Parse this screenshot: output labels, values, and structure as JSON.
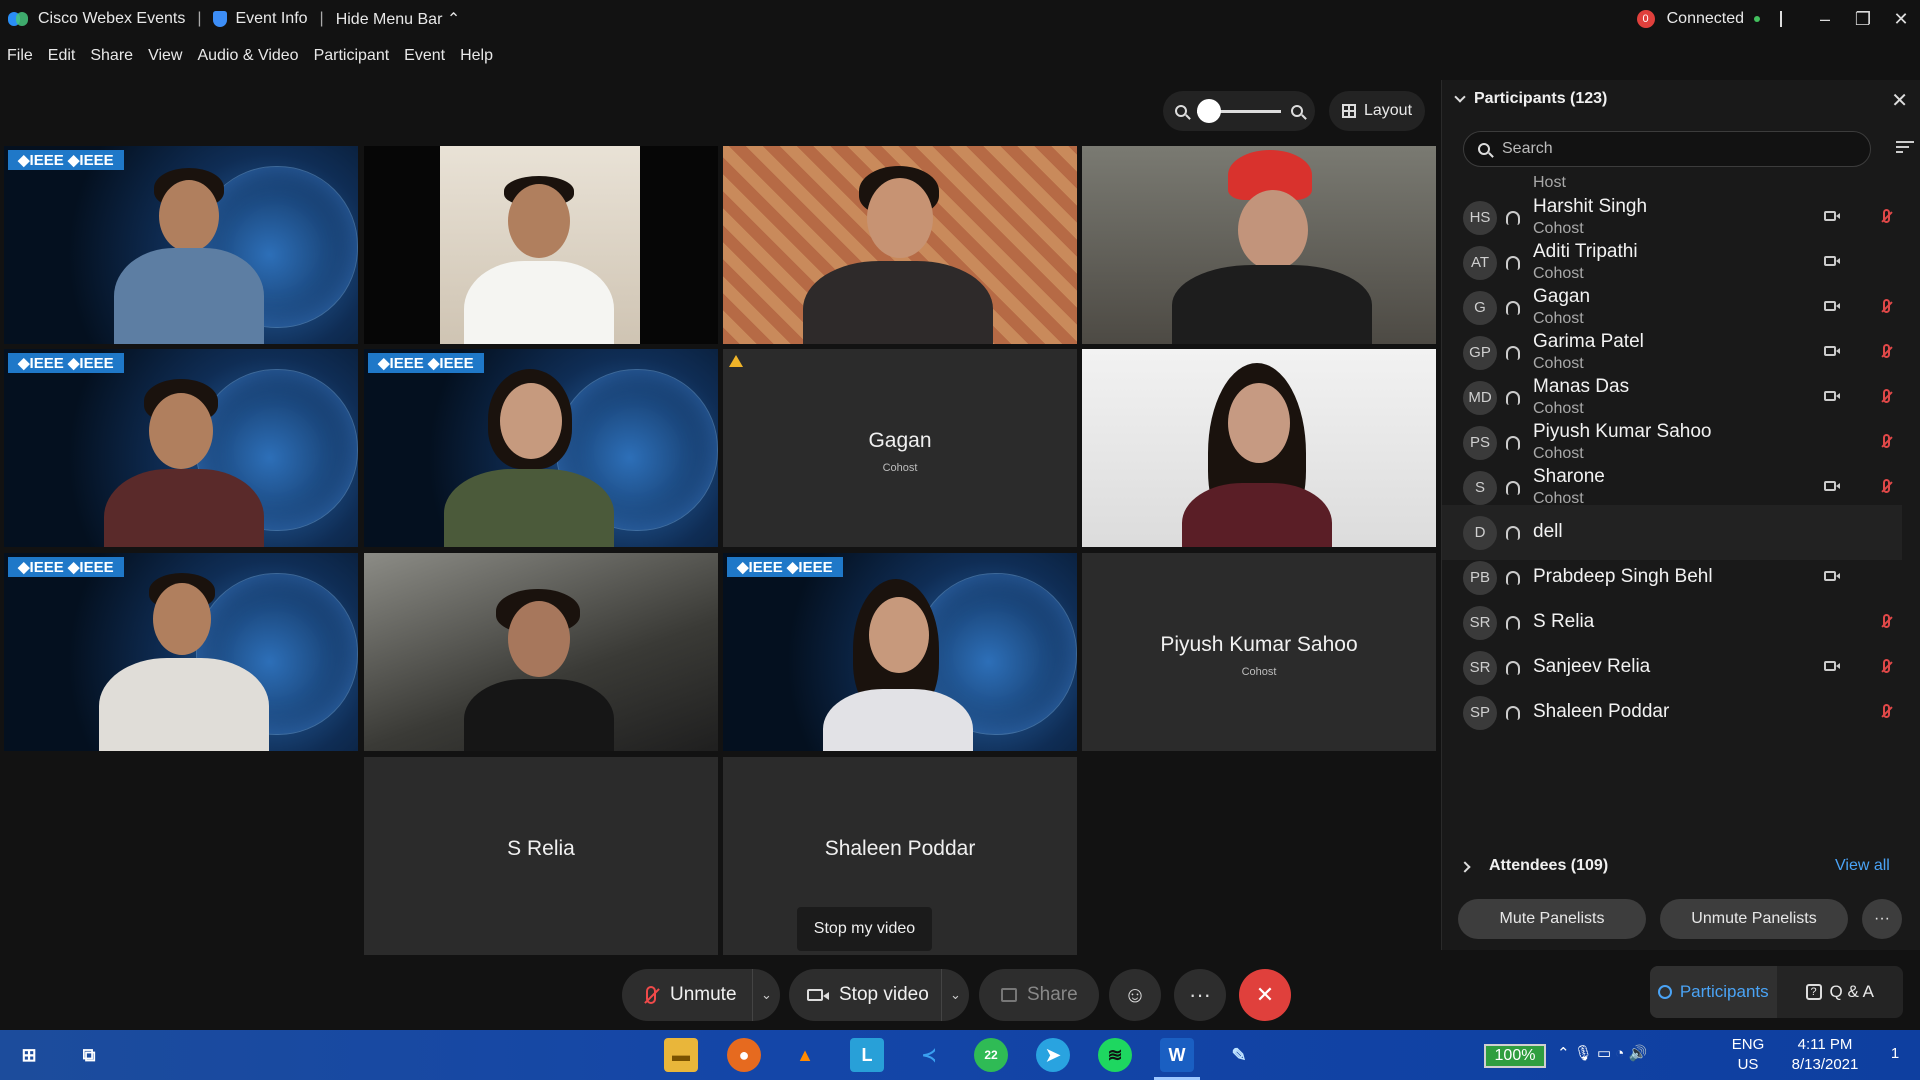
{
  "titlebar": {
    "app_name": "Cisco Webex Events",
    "event_info": "Event Info",
    "hide_menu": "Hide Menu Bar",
    "connection_count": "0",
    "connection_status": "Connected"
  },
  "menu": [
    "File",
    "Edit",
    "Share",
    "View",
    "Audio & Video",
    "Participant",
    "Event",
    "Help"
  ],
  "toolbar": {
    "layout_label": "Layout",
    "zoom_level": 0.0
  },
  "tiles": {
    "gagan": {
      "name": "Gagan",
      "role": "Cohost"
    },
    "piyush": {
      "name": "Piyush Kumar Sahoo",
      "role": "Cohost"
    },
    "srelia": {
      "name": "S Relia"
    },
    "shaleen": {
      "name": "Shaleen Poddar"
    },
    "ieee_badge": "◆IEEE ◆IEEE"
  },
  "tooltip": "Stop my video",
  "controls": {
    "unmute": "Unmute",
    "stop_video": "Stop video",
    "share": "Share"
  },
  "panel": {
    "title": "Participants (123)",
    "search_placeholder": "Search",
    "host_label": "Host",
    "participants": [
      {
        "initials": "HS",
        "name": "Harshit Singh",
        "role": "Cohost",
        "video": true,
        "muted": true
      },
      {
        "initials": "AT",
        "name": "Aditi Tripathi",
        "role": "Cohost",
        "video": true,
        "muted": false
      },
      {
        "initials": "G",
        "name": "Gagan",
        "role": "Cohost",
        "video": true,
        "muted": true
      },
      {
        "initials": "GP",
        "name": "Garima Patel",
        "role": "Cohost",
        "video": true,
        "muted": true
      },
      {
        "initials": "MD",
        "name": "Manas Das",
        "role": "Cohost",
        "video": true,
        "muted": true
      },
      {
        "initials": "PS",
        "name": "Piyush Kumar Sahoo",
        "role": "Cohost",
        "video": false,
        "muted": true
      },
      {
        "initials": "S",
        "name": "Sharone",
        "role": "Cohost",
        "video": true,
        "muted": true
      },
      {
        "initials": "D",
        "name": "dell",
        "role": "",
        "video": false,
        "muted": false
      },
      {
        "initials": "PB",
        "name": "Prabdeep Singh Behl",
        "role": "",
        "video": true,
        "muted": false
      },
      {
        "initials": "SR",
        "name": "S Relia",
        "role": "",
        "video": false,
        "muted": true
      },
      {
        "initials": "SR",
        "name": "Sanjeev Relia",
        "role": "",
        "video": true,
        "muted": true
      },
      {
        "initials": "SP",
        "name": "Shaleen Poddar",
        "role": "",
        "video": false,
        "muted": true
      }
    ],
    "attendees": "Attendees (109)",
    "view_all": "View all",
    "mute_panelists": "Mute Panelists",
    "unmute_panelists": "Unmute Panelists",
    "more": "···"
  },
  "tabs": {
    "participants": "Participants",
    "qa": "Q & A"
  },
  "taskbar": {
    "battery": "100%",
    "lang_top": "ENG",
    "lang_bottom": "US",
    "time": "4:11 PM",
    "date": "8/13/2021",
    "whatsapp_badge": "22",
    "notif_count": "1"
  }
}
